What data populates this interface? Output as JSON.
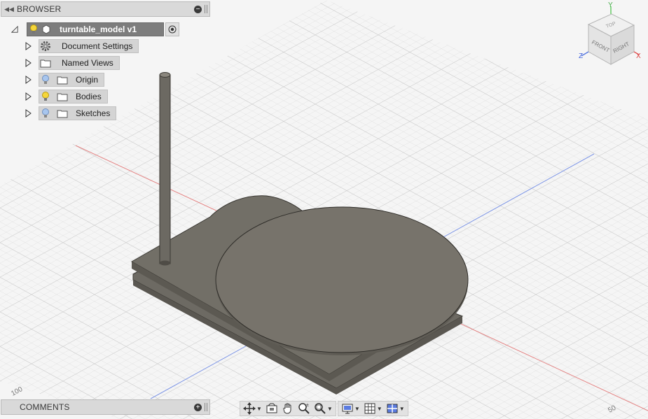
{
  "browser": {
    "title": "BROWSER",
    "root": {
      "label": "turntable_model v1"
    },
    "items": [
      {
        "label": "Document Settings",
        "icon": "gear-icon"
      },
      {
        "label": "Named Views",
        "icon": "folder-icon"
      },
      {
        "label": "Origin",
        "icon": "lightbulb-icon"
      },
      {
        "label": "Bodies",
        "icon": "lightbulb-icon"
      },
      {
        "label": "Sketches",
        "icon": "lightbulb-icon"
      }
    ]
  },
  "comments": {
    "title": "COMMENTS"
  },
  "viewcube": {
    "top": "TOP",
    "front": "FRONT",
    "right": "RIGHT",
    "axis_x": "X",
    "axis_y": "Y",
    "axis_z": "Z"
  },
  "grid_labels": {
    "left": "100",
    "right": "50"
  },
  "colors": {
    "panel": "#d9d9d9",
    "model": "#6f6b63",
    "axis_x": "#e05a5a",
    "axis_y": "#5a7be0",
    "bulb_on": "#f5d63a",
    "bulb_off": "#a8c6ee"
  }
}
